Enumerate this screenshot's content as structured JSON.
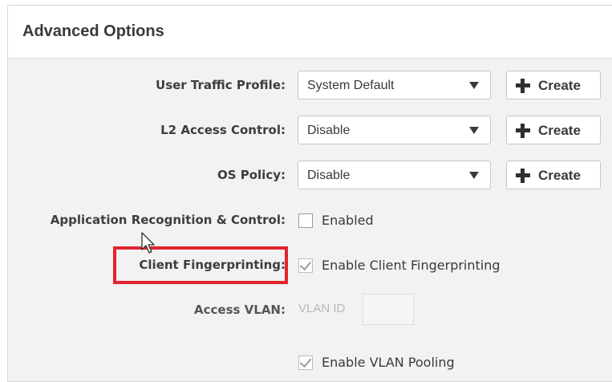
{
  "panel": {
    "title": "Advanced Options"
  },
  "fields": {
    "user_traffic_profile": {
      "label": "User Traffic Profile:",
      "value": "System Default",
      "create_label": "Create"
    },
    "l2_access_control": {
      "label": "L2 Access Control:",
      "value": "Disable",
      "create_label": "Create"
    },
    "os_policy": {
      "label": "OS Policy:",
      "value": "Disable",
      "create_label": "Create"
    },
    "app_recognition": {
      "label": "Application Recognition & Control:",
      "checkbox_label": "Enabled",
      "checked": false
    },
    "client_fingerprinting": {
      "label": "Client Fingerprinting:",
      "checkbox_label": "Enable Client Fingerprinting",
      "checked": true
    },
    "access_vlan": {
      "label": "Access VLAN:",
      "vlan_id_label": "VLAN ID",
      "vlan_id_value": ""
    },
    "vlan_pooling": {
      "checkbox_label": "Enable VLAN Pooling",
      "checked": true
    }
  },
  "colors": {
    "highlight": "#e0242e",
    "panel_bg": "#f2f2f2",
    "header_bg": "#ffffff"
  },
  "icons": {
    "create": "plus-icon",
    "dropdown": "chevron-down-icon",
    "checkbox_checked": "checkmark-icon",
    "mouse": "cursor-icon"
  }
}
